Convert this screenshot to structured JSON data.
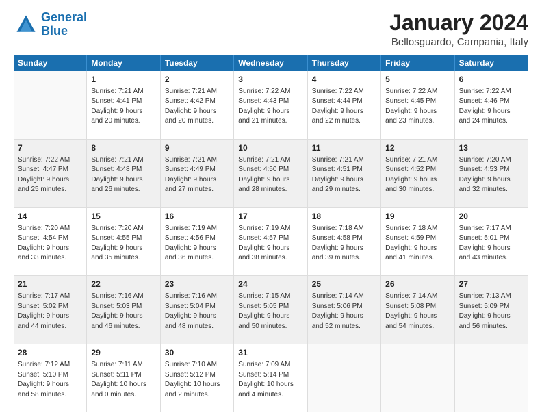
{
  "logo": {
    "line1": "General",
    "line2": "Blue",
    "icon": "▶"
  },
  "title": "January 2024",
  "subtitle": "Bellosguardo, Campania, Italy",
  "weekdays": [
    "Sunday",
    "Monday",
    "Tuesday",
    "Wednesday",
    "Thursday",
    "Friday",
    "Saturday"
  ],
  "weeks": [
    [
      {
        "day": "",
        "empty": true
      },
      {
        "day": "1",
        "lines": [
          "Sunrise: 7:21 AM",
          "Sunset: 4:41 PM",
          "Daylight: 9 hours",
          "and 20 minutes."
        ]
      },
      {
        "day": "2",
        "lines": [
          "Sunrise: 7:21 AM",
          "Sunset: 4:42 PM",
          "Daylight: 9 hours",
          "and 20 minutes."
        ]
      },
      {
        "day": "3",
        "lines": [
          "Sunrise: 7:22 AM",
          "Sunset: 4:43 PM",
          "Daylight: 9 hours",
          "and 21 minutes."
        ]
      },
      {
        "day": "4",
        "lines": [
          "Sunrise: 7:22 AM",
          "Sunset: 4:44 PM",
          "Daylight: 9 hours",
          "and 22 minutes."
        ]
      },
      {
        "day": "5",
        "lines": [
          "Sunrise: 7:22 AM",
          "Sunset: 4:45 PM",
          "Daylight: 9 hours",
          "and 23 minutes."
        ]
      },
      {
        "day": "6",
        "lines": [
          "Sunrise: 7:22 AM",
          "Sunset: 4:46 PM",
          "Daylight: 9 hours",
          "and 24 minutes."
        ]
      }
    ],
    [
      {
        "day": "7",
        "shaded": true,
        "lines": [
          "Sunrise: 7:22 AM",
          "Sunset: 4:47 PM",
          "Daylight: 9 hours",
          "and 25 minutes."
        ]
      },
      {
        "day": "8",
        "shaded": true,
        "lines": [
          "Sunrise: 7:21 AM",
          "Sunset: 4:48 PM",
          "Daylight: 9 hours",
          "and 26 minutes."
        ]
      },
      {
        "day": "9",
        "shaded": true,
        "lines": [
          "Sunrise: 7:21 AM",
          "Sunset: 4:49 PM",
          "Daylight: 9 hours",
          "and 27 minutes."
        ]
      },
      {
        "day": "10",
        "shaded": true,
        "lines": [
          "Sunrise: 7:21 AM",
          "Sunset: 4:50 PM",
          "Daylight: 9 hours",
          "and 28 minutes."
        ]
      },
      {
        "day": "11",
        "shaded": true,
        "lines": [
          "Sunrise: 7:21 AM",
          "Sunset: 4:51 PM",
          "Daylight: 9 hours",
          "and 29 minutes."
        ]
      },
      {
        "day": "12",
        "shaded": true,
        "lines": [
          "Sunrise: 7:21 AM",
          "Sunset: 4:52 PM",
          "Daylight: 9 hours",
          "and 30 minutes."
        ]
      },
      {
        "day": "13",
        "shaded": true,
        "lines": [
          "Sunrise: 7:20 AM",
          "Sunset: 4:53 PM",
          "Daylight: 9 hours",
          "and 32 minutes."
        ]
      }
    ],
    [
      {
        "day": "14",
        "lines": [
          "Sunrise: 7:20 AM",
          "Sunset: 4:54 PM",
          "Daylight: 9 hours",
          "and 33 minutes."
        ]
      },
      {
        "day": "15",
        "lines": [
          "Sunrise: 7:20 AM",
          "Sunset: 4:55 PM",
          "Daylight: 9 hours",
          "and 35 minutes."
        ]
      },
      {
        "day": "16",
        "lines": [
          "Sunrise: 7:19 AM",
          "Sunset: 4:56 PM",
          "Daylight: 9 hours",
          "and 36 minutes."
        ]
      },
      {
        "day": "17",
        "lines": [
          "Sunrise: 7:19 AM",
          "Sunset: 4:57 PM",
          "Daylight: 9 hours",
          "and 38 minutes."
        ]
      },
      {
        "day": "18",
        "lines": [
          "Sunrise: 7:18 AM",
          "Sunset: 4:58 PM",
          "Daylight: 9 hours",
          "and 39 minutes."
        ]
      },
      {
        "day": "19",
        "lines": [
          "Sunrise: 7:18 AM",
          "Sunset: 4:59 PM",
          "Daylight: 9 hours",
          "and 41 minutes."
        ]
      },
      {
        "day": "20",
        "lines": [
          "Sunrise: 7:17 AM",
          "Sunset: 5:01 PM",
          "Daylight: 9 hours",
          "and 43 minutes."
        ]
      }
    ],
    [
      {
        "day": "21",
        "shaded": true,
        "lines": [
          "Sunrise: 7:17 AM",
          "Sunset: 5:02 PM",
          "Daylight: 9 hours",
          "and 44 minutes."
        ]
      },
      {
        "day": "22",
        "shaded": true,
        "lines": [
          "Sunrise: 7:16 AM",
          "Sunset: 5:03 PM",
          "Daylight: 9 hours",
          "and 46 minutes."
        ]
      },
      {
        "day": "23",
        "shaded": true,
        "lines": [
          "Sunrise: 7:16 AM",
          "Sunset: 5:04 PM",
          "Daylight: 9 hours",
          "and 48 minutes."
        ]
      },
      {
        "day": "24",
        "shaded": true,
        "lines": [
          "Sunrise: 7:15 AM",
          "Sunset: 5:05 PM",
          "Daylight: 9 hours",
          "and 50 minutes."
        ]
      },
      {
        "day": "25",
        "shaded": true,
        "lines": [
          "Sunrise: 7:14 AM",
          "Sunset: 5:06 PM",
          "Daylight: 9 hours",
          "and 52 minutes."
        ]
      },
      {
        "day": "26",
        "shaded": true,
        "lines": [
          "Sunrise: 7:14 AM",
          "Sunset: 5:08 PM",
          "Daylight: 9 hours",
          "and 54 minutes."
        ]
      },
      {
        "day": "27",
        "shaded": true,
        "lines": [
          "Sunrise: 7:13 AM",
          "Sunset: 5:09 PM",
          "Daylight: 9 hours",
          "and 56 minutes."
        ]
      }
    ],
    [
      {
        "day": "28",
        "lines": [
          "Sunrise: 7:12 AM",
          "Sunset: 5:10 PM",
          "Daylight: 9 hours",
          "and 58 minutes."
        ]
      },
      {
        "day": "29",
        "lines": [
          "Sunrise: 7:11 AM",
          "Sunset: 5:11 PM",
          "Daylight: 10 hours",
          "and 0 minutes."
        ]
      },
      {
        "day": "30",
        "lines": [
          "Sunrise: 7:10 AM",
          "Sunset: 5:12 PM",
          "Daylight: 10 hours",
          "and 2 minutes."
        ]
      },
      {
        "day": "31",
        "lines": [
          "Sunrise: 7:09 AM",
          "Sunset: 5:14 PM",
          "Daylight: 10 hours",
          "and 4 minutes."
        ]
      },
      {
        "day": "",
        "empty": true
      },
      {
        "day": "",
        "empty": true
      },
      {
        "day": "",
        "empty": true
      }
    ]
  ]
}
